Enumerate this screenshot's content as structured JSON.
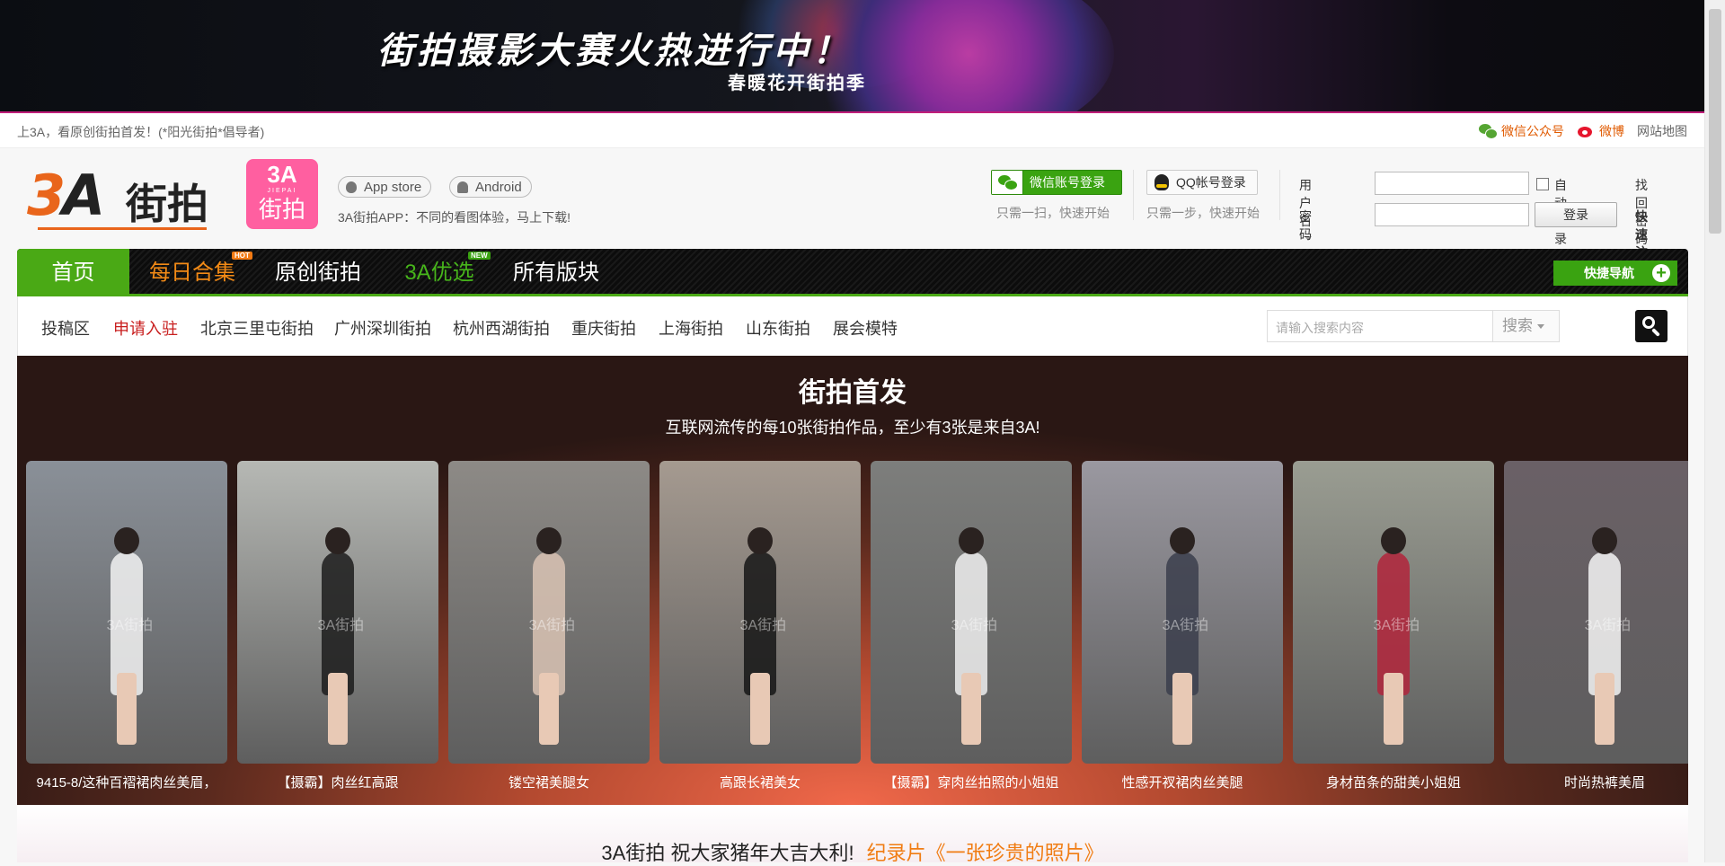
{
  "banner": {
    "headline": "街拍摄影大赛火热进行中！",
    "subline": "春暖花开街拍季"
  },
  "topbar": {
    "welcome": "上3A，看原创街拍首发！(*阳光街拍*倡导者)",
    "wechat": "微信公众号",
    "weibo": "微博",
    "sitemap": "网站地图"
  },
  "header": {
    "logo_text": "3A街拍",
    "app_logo_top": "3A",
    "app_logo_mid": "JIEPAI",
    "app_logo_bottom": "街拍",
    "appstore": "App store",
    "android": "Android",
    "app_tip": "3A街拍APP：不同的看图体验，马上下载!",
    "wechat_login": "微信账号登录",
    "wechat_tip": "只需一扫，快速开始",
    "qq_login": "QQ帐号登录",
    "qq_tip": "只需一步，快速开始",
    "username_label": "用户名",
    "password_label": "密码",
    "auto_login": "自动登录",
    "login_button": "登录",
    "find_password": "找回密码",
    "quick_register": "快速注册"
  },
  "nav": {
    "items": [
      "首页",
      "每日合集",
      "原创街拍",
      "3A优选",
      "所有版块"
    ],
    "hot_tag": "HOT",
    "new_tag": "NEW",
    "quick_nav": "快捷导航"
  },
  "subnav": {
    "items": [
      "投稿区",
      "申请入驻",
      "北京三里屯街拍",
      "广州深圳街拍",
      "杭州西湖街拍",
      "重庆街拍",
      "上海街拍",
      "山东街拍",
      "展会模特"
    ],
    "search_placeholder": "请输入搜索内容",
    "search_type": "搜索"
  },
  "feature": {
    "title": "街拍首发",
    "subtitle": "互联网流传的每10张街拍作品，至少有3张是来自3A!",
    "watermark": "3A街拍",
    "cards": [
      {
        "caption": "9415-8/这种百褶裙肉丝美眉，",
        "bg": "#8a9098",
        "fig": "#f2f2f2"
      },
      {
        "caption": "【摄霸】肉丝红高跟",
        "bg": "#b6b8b4",
        "fig": "#1c1c1c"
      },
      {
        "caption": "镂空裙美腿女",
        "bg": "#8d8a86",
        "fig": "#d9c3b4"
      },
      {
        "caption": "高跟长裙美女",
        "bg": "#a59a90",
        "fig": "#161616"
      },
      {
        "caption": "【摄霸】穿肉丝拍照的小姐姐",
        "bg": "#7d7e7c",
        "fig": "#efefef"
      },
      {
        "caption": "性感开衩裙肉丝美腿",
        "bg": "#9a98a0",
        "fig": "#3b3e4c"
      },
      {
        "caption": "身材苗条的甜美小姐姐",
        "bg": "#9a9d92",
        "fig": "#b2243b"
      },
      {
        "caption": "时尚热裤美眉",
        "bg": "#6a6066",
        "fig": "#f4f4f4"
      }
    ]
  },
  "bottom": {
    "greeting": "3A街拍 祝大家猪年大吉大利!",
    "link": "纪录片《一张珍贵的照片》"
  }
}
